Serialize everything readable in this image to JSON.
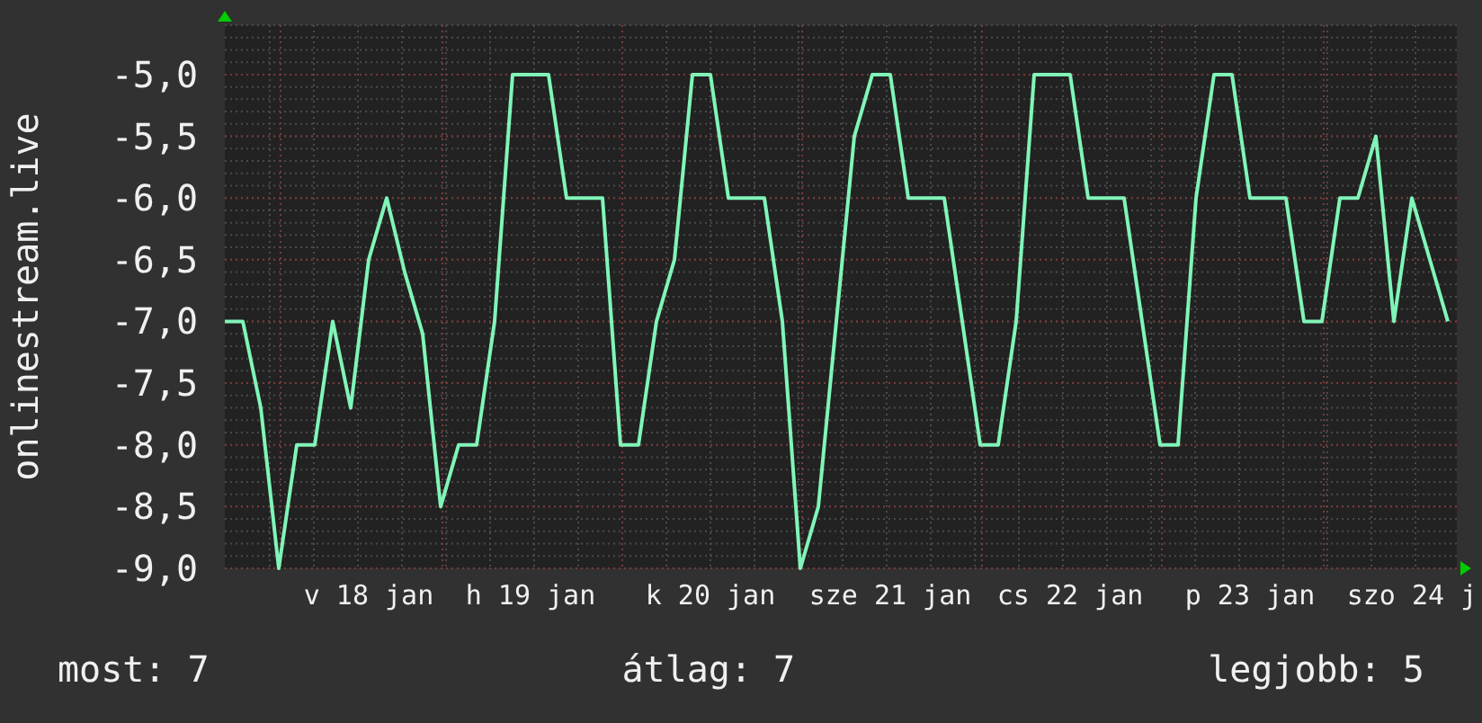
{
  "chart_data": {
    "type": "line",
    "ylabel": "onlinestream.live",
    "grid": true,
    "ylim": [
      -9,
      -4.6
    ],
    "yticks": [
      {
        "value": -5,
        "label": "-5,0"
      },
      {
        "value": -5.5,
        "label": "-5,5"
      },
      {
        "value": -6,
        "label": "-6,0"
      },
      {
        "value": -6.5,
        "label": "-6,5"
      },
      {
        "value": -7,
        "label": "-7,0"
      },
      {
        "value": -7.5,
        "label": "-7,5"
      },
      {
        "value": -8,
        "label": "-8,0"
      },
      {
        "value": -8.5,
        "label": "-8,5"
      },
      {
        "value": -9,
        "label": "-9,0"
      }
    ],
    "categories": [
      null,
      null,
      null,
      null,
      null,
      null,
      null,
      null,
      "v 18 jan",
      null,
      null,
      null,
      null,
      null,
      null,
      null,
      null,
      "h 19 jan",
      null,
      null,
      null,
      null,
      null,
      null,
      null,
      null,
      null,
      "k 20 jan",
      null,
      null,
      null,
      null,
      null,
      null,
      null,
      null,
      null,
      "sze 21 jan",
      null,
      null,
      null,
      null,
      null,
      null,
      null,
      null,
      null,
      "cs 22 jan",
      null,
      null,
      null,
      null,
      null,
      null,
      null,
      null,
      null,
      "p 23 jan",
      null,
      null,
      null,
      null,
      null,
      null,
      null,
      null,
      "szo 24 j",
      null,
      null
    ],
    "values": [
      -7,
      -7,
      -7.7,
      -9,
      -8,
      -8,
      -7,
      -7.7,
      -6.5,
      -6,
      -6.6,
      -7.1,
      -8.5,
      -8,
      -8,
      -7,
      -5,
      -5,
      -5,
      -6,
      -6,
      -6,
      -8,
      -8,
      -7,
      -6.5,
      -5,
      -5,
      -6,
      -6,
      -6,
      -7,
      -9,
      -8.5,
      -7,
      -5.5,
      -5,
      -5,
      -6,
      -6,
      -6,
      -7,
      -8,
      -8,
      -7,
      -5,
      -5,
      -5,
      -6,
      -6,
      -6,
      -7,
      -8,
      -8,
      -6,
      -5,
      -5,
      -6,
      -6,
      -6,
      -7,
      -7,
      -6,
      -6,
      -5.5,
      -7,
      -6,
      -6.5,
      -7
    ]
  },
  "stats": [
    "most: 7",
    "átlag: 7",
    "legjobb: 5"
  ]
}
